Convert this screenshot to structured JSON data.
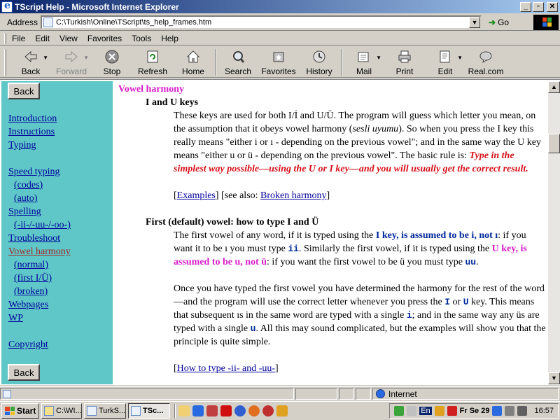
{
  "window": {
    "title": "TScript Help - Microsoft Internet Explorer"
  },
  "address": {
    "label": "Address",
    "url": "C:\\Turkish\\Online\\TScript\\ts_help_frames.htm",
    "go_label": "Go"
  },
  "menu": [
    "File",
    "Edit",
    "View",
    "Favorites",
    "Tools",
    "Help"
  ],
  "toolbar": {
    "back": "Back",
    "forward": "Forward",
    "stop": "Stop",
    "refresh": "Refresh",
    "home": "Home",
    "search": "Search",
    "favorites": "Favorites",
    "history": "History",
    "mail": "Mail",
    "print": "Print",
    "edit": "Edit",
    "real": "Real.com"
  },
  "nav": {
    "back_top": "Back",
    "back_bottom": "Back",
    "items": [
      {
        "label": "Introduction"
      },
      {
        "label": "Instructions"
      },
      {
        "label": "Typing"
      },
      {
        "label": "Speed typing"
      },
      {
        "label": "(codes)"
      },
      {
        "label": "(auto)"
      },
      {
        "label": "Spelling"
      },
      {
        "label": "(-ii-/-uu-/-oo-)"
      },
      {
        "label": "Troubleshoot"
      },
      {
        "label": "Vowel harmony"
      },
      {
        "label": "(normal)"
      },
      {
        "label": "(first I/Ü)"
      },
      {
        "label": "(broken)"
      },
      {
        "label": "Webpages"
      },
      {
        "label": "WP"
      },
      {
        "label": "Copyright"
      }
    ]
  },
  "doc": {
    "heading": "Vowel harmony",
    "s1_title": "I and U keys",
    "p1_a": "These keys are used for both I/İ and U/Ü. The program will guess which letter you mean, on the assumption that it obeys vowel harmony (",
    "p1_sesli": "sesli uyumu",
    "p1_b": "). So when you press the I key this really means \"either i or ı - depending on the previous vowel\"; and in the same way the U key means \"either u or ü - depending on the previous vowel\". The basic rule is: ",
    "p1_red": "Type in the simplest way possible—using the U or I key—and you will usually get the correct result.",
    "p2_open": "[",
    "p2_examples": "Examples",
    "p2_mid": "] [see also: ",
    "p2_broken": "Broken harmony",
    "p2_close": "]",
    "s2_title": "First (default) vowel: how to type I and Ü",
    "p3_a": "The first vowel of any word, if it is typed using the ",
    "p3_blue": "I key, is assumed to be i, not ı",
    "p3_b": ": if you want it to be ı you must type ",
    "p3_code1": "ii",
    "p3_c": ". Similarly the first vowel, if it is typed using the ",
    "p3_mag": "U key, is assumed to be u, not ü",
    "p3_d": ": if you want the first vowel to be ü you must type ",
    "p3_code2": "uu",
    "p3_e": ".",
    "p4_a": "Once you have typed the first vowel you have determined the harmony for the rest of the word—and the program will use the correct letter whenever you press the ",
    "p4_k1": "I",
    "p4_or": " or ",
    "p4_k2": "U",
    "p4_b": " key. This means that subsequent ıs in the same word are typed with a single ",
    "p4_k3": "i",
    "p4_c": "; and in the same way any üs are typed with a single ",
    "p4_k4": "u",
    "p4_d": ". All this may sound complicated, but the examples will show you that the principle is quite simple.",
    "p5_open": "[",
    "p5_link": "How to type -ii- and -uu-",
    "p5_close": "]"
  },
  "status": {
    "zone": "Internet"
  },
  "taskbar": {
    "start": "Start",
    "tasks": [
      "C:\\WI...",
      "TurkS...",
      "TSc..."
    ],
    "tray_lang": "En",
    "tray_date": "Fr Se 29",
    "clock": "16:57"
  }
}
